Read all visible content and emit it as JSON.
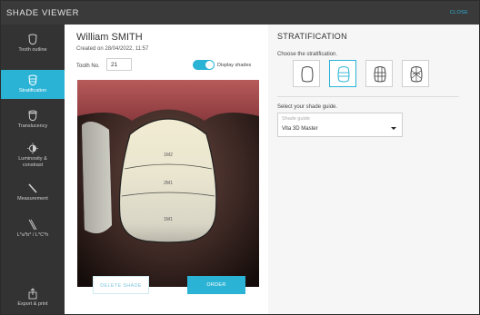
{
  "app": {
    "title": "SHADE VIEWER",
    "close_label": "CLOSE"
  },
  "sidebar": {
    "items": [
      {
        "label": "Tooth outline",
        "icon": "tooth-icon",
        "active": false
      },
      {
        "label": "Stratification",
        "icon": "stratification-icon",
        "active": true
      },
      {
        "label": "Translucency",
        "icon": "translucency-icon",
        "active": false
      },
      {
        "label_line1": "Luminosity &",
        "label_line2": "constrast",
        "icon": "luminosity-icon",
        "active": false
      },
      {
        "label": "Measurement",
        "icon": "measurement-icon",
        "active": false
      },
      {
        "label": "L*a*b* / L*C*h",
        "icon": "lab-icon",
        "active": false
      },
      {
        "label": "Export & print",
        "icon": "export-icon",
        "active": false
      }
    ]
  },
  "patient": {
    "name": "William SMITH",
    "created": "Created on 28/04/2022, 11:57",
    "tooth_no_label": "Tooth No.",
    "tooth_no_value": "21"
  },
  "display_shades": {
    "label": "Display shades",
    "on": true
  },
  "photo": {
    "zones": [
      "1M2",
      "2M1",
      "1M1"
    ]
  },
  "buttons": {
    "delete": "DELETE SHADE",
    "order": "ORDER"
  },
  "stratification": {
    "title": "STRATIFICATION",
    "subtitle": "Choose the stratification.",
    "options": [
      {
        "icon": "tooth-outline-icon",
        "selected": false
      },
      {
        "icon": "tooth-horizontal-layers-icon",
        "selected": true
      },
      {
        "icon": "tooth-grid-icon",
        "selected": false
      },
      {
        "icon": "tooth-custom-zones-icon",
        "selected": false
      }
    ]
  },
  "shade_guide": {
    "subtitle": "Select your shade guide.",
    "placeholder": "Shade guide",
    "value": "Vita 3D Master"
  },
  "colors": {
    "accent": "#2bb3d6",
    "sidebar": "#333333",
    "topbar": "#3a3a3a"
  }
}
